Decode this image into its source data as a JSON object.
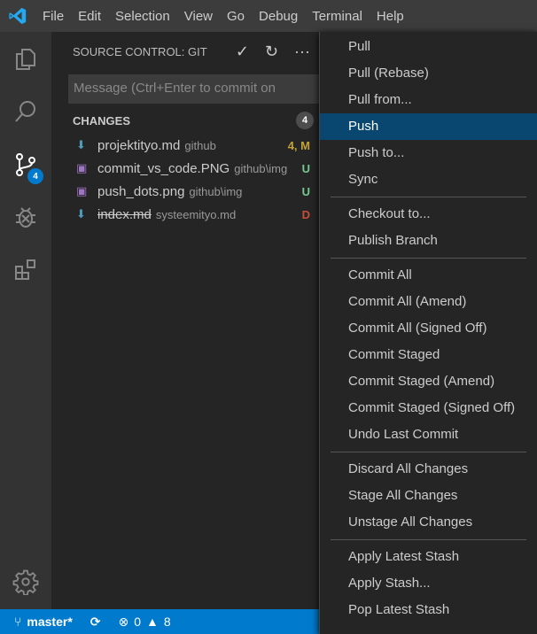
{
  "menubar": {
    "items": [
      "File",
      "Edit",
      "Selection",
      "View",
      "Go",
      "Debug",
      "Terminal",
      "Help"
    ]
  },
  "activity": {
    "scm_badge": "4"
  },
  "sidebar": {
    "title": "SOURCE CONTROL: GIT",
    "message_placeholder": "Message (Ctrl+Enter to commit on",
    "changes_label": "CHANGES",
    "changes_count": "4",
    "files": [
      {
        "name": "projektityo.md",
        "dir": "github",
        "status": "4, M",
        "color": "#c5a332",
        "icon": "arrow-down-icon",
        "deleted": false
      },
      {
        "name": "commit_vs_code.PNG",
        "dir": "github\\img",
        "status": "U",
        "color": "#73c991",
        "icon": "image-icon",
        "deleted": false
      },
      {
        "name": "push_dots.png",
        "dir": "github\\img",
        "status": "U",
        "color": "#73c991",
        "icon": "image-icon",
        "deleted": false
      },
      {
        "name": "index.md",
        "dir": "systeemityo.md",
        "status": "D",
        "color": "#c74e39",
        "icon": "arrow-down-icon",
        "deleted": true
      }
    ]
  },
  "status": {
    "branch": "master*",
    "errors": "0",
    "warnings": "8"
  },
  "context_menu": {
    "groups": [
      [
        "Pull",
        "Pull (Rebase)",
        "Pull from...",
        "Push",
        "Push to...",
        "Sync"
      ],
      [
        "Checkout to...",
        "Publish Branch"
      ],
      [
        "Commit All",
        "Commit All (Amend)",
        "Commit All (Signed Off)",
        "Commit Staged",
        "Commit Staged (Amend)",
        "Commit Staged (Signed Off)",
        "Undo Last Commit"
      ],
      [
        "Discard All Changes",
        "Stage All Changes",
        "Unstage All Changes"
      ],
      [
        "Apply Latest Stash",
        "Apply Stash...",
        "Pop Latest Stash"
      ]
    ],
    "selected": "Push"
  },
  "colors": {
    "accent": "#007acc",
    "selection": "#094771"
  }
}
